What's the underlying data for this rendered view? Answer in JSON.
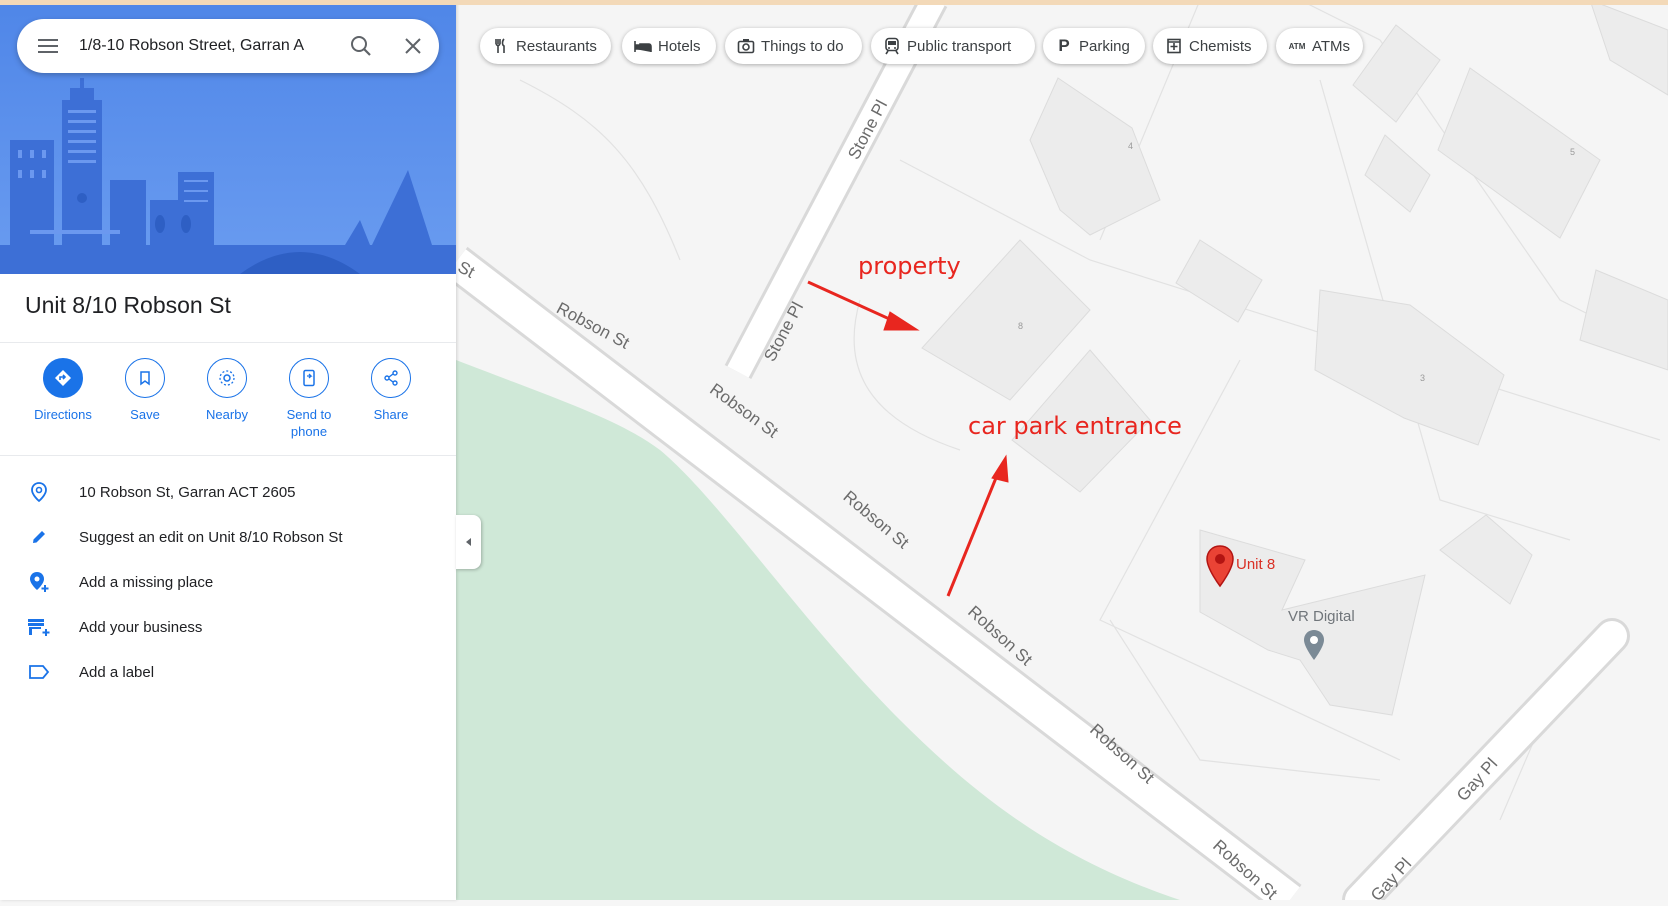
{
  "search": {
    "query": "1/8-10 Robson Street, Garran A"
  },
  "place": {
    "title": "Unit 8/10 Robson St"
  },
  "actions": [
    {
      "label": "Directions",
      "icon": "directions-icon"
    },
    {
      "label": "Save",
      "icon": "bookmark-icon"
    },
    {
      "label": "Nearby",
      "icon": "nearby-icon"
    },
    {
      "label": "Send to\nphone",
      "icon": "send-to-phone-icon"
    },
    {
      "label": "Share",
      "icon": "share-icon"
    }
  ],
  "info": [
    {
      "text": "10 Robson St, Garran ACT 2605",
      "icon": "location-pin-icon"
    },
    {
      "text": "Suggest an edit on Unit 8/10 Robson St",
      "icon": "pencil-icon"
    },
    {
      "text": "Add a missing place",
      "icon": "add-place-icon"
    },
    {
      "text": "Add your business",
      "icon": "add-business-icon"
    },
    {
      "text": "Add a label",
      "icon": "label-icon"
    }
  ],
  "chips": [
    {
      "label": "Restaurants",
      "icon": "fork-knife-icon"
    },
    {
      "label": "Hotels",
      "icon": "bed-icon"
    },
    {
      "label": "Things to do",
      "icon": "camera-icon"
    },
    {
      "label": "Public transport",
      "icon": "tram-icon"
    },
    {
      "label": "Parking",
      "icon": "parking-icon"
    },
    {
      "label": "Chemists",
      "icon": "pharmacy-icon"
    },
    {
      "label": "ATMs",
      "icon": "atm-icon"
    }
  ],
  "map": {
    "streets": {
      "robson": "Robson St",
      "robson_cut": "St",
      "stone": "Stone Pl",
      "gay": "Gay Pl"
    },
    "building_numbers": [
      "4",
      "5",
      "8",
      "3"
    ],
    "pins": {
      "unit": "Unit 8",
      "vr": "VR Digital"
    },
    "annotations": {
      "property": "property",
      "car_park": "car park entrance"
    }
  },
  "colors": {
    "accent": "#1a73e8",
    "annotation": "#e8261f",
    "park": "#cfe8d7",
    "road": "#ffffff"
  }
}
